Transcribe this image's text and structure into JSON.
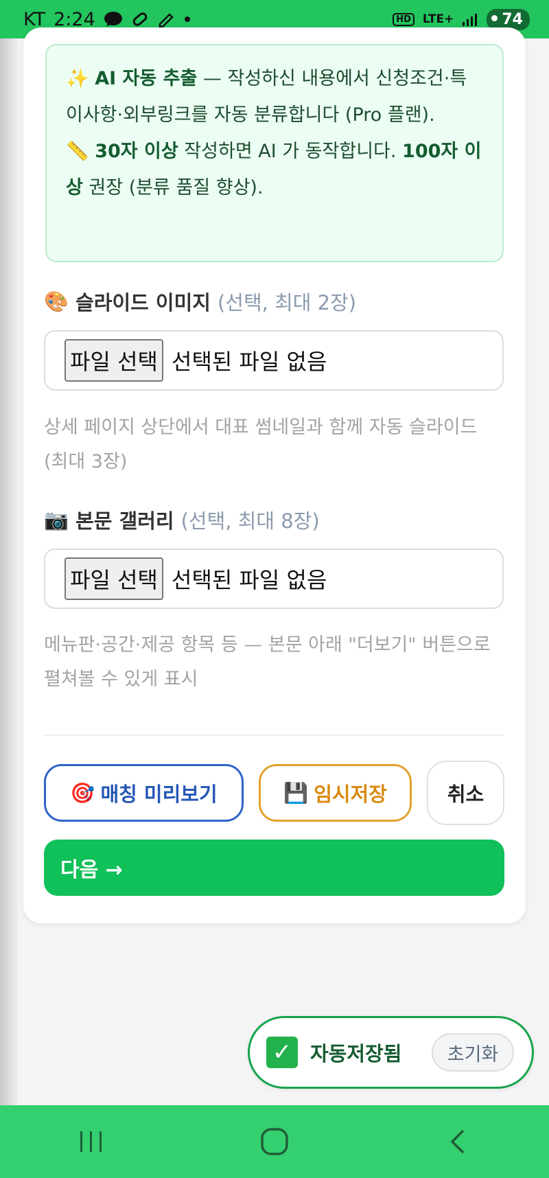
{
  "status_bar": {
    "carrier": "KT",
    "time": "2:24",
    "battery": "74",
    "hd_label": "HD",
    "network_label": "LTE+"
  },
  "notice": {
    "line1_bold": "AI 자동 추출",
    "line1_text": " — 작성하신 내용에서 신청조건·특이사항·외부링크를 자동 분류합니다 (Pro 플랜).",
    "line2_bold1": "30자 이상",
    "line2_text1": " 작성하면 AI 가 동작합니다. ",
    "line2_bold2": "100자 이상",
    "line2_text2": " 권장 (분류 품질 향상).",
    "icon1": "✨",
    "icon2": "📏"
  },
  "slide_section": {
    "icon": "🎨",
    "label": "슬라이드 이미지",
    "sub": "(선택, 최대 2장)",
    "file_button": "파일 선택",
    "file_status": "선택된 파일 없음",
    "help": "상세 페이지 상단에서 대표 썸네일과 함께 자동 슬라이드 (최대 3장)"
  },
  "gallery_section": {
    "icon": "📷",
    "label": "본문 갤러리",
    "sub": "(선택, 최대 8장)",
    "file_button": "파일 선택",
    "file_status": "선택된 파일 없음",
    "help": "메뉴판·공간·제공 항목 등 — 본문 아래 \"더보기\" 버튼으로 펼쳐볼 수 있게 표시"
  },
  "actions": {
    "preview_icon": "🎯",
    "preview_label": "매칭 미리보기",
    "save_icon": "💾",
    "save_label": "임시저장",
    "cancel_label": "취소",
    "next_label": "다음 →"
  },
  "autosave": {
    "check_icon": "✓",
    "label": "자동저장됨",
    "reset_label": "초기화"
  },
  "colors": {
    "accent_green": "#10c058",
    "status_bar": "#22c55e",
    "nav_bar": "#34cf6f"
  }
}
